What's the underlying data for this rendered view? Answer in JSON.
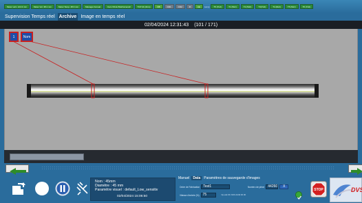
{
  "status_bar": {
    "items": [
      {
        "label": "Meter vel1. 124.3 mm",
        "style": "green"
      },
      {
        "label": "Meter Vel. 38.1 mm",
        "style": "green"
      },
      {
        "label": "Meter Temp. 48.3 mm",
        "style": "green"
      },
      {
        "label": "Manager Annual",
        "style": "green"
      },
      {
        "label": "Cam VKLE Bra/Camera0",
        "style": "green"
      },
      {
        "label": "TCP (0) (0ms)",
        "style": "green"
      },
      {
        "label": "DB",
        "style": "green"
      },
      {
        "label": "CD1",
        "style": "grey"
      },
      {
        "label": "CD2",
        "style": "grey"
      },
      {
        "label": "R",
        "style": "grey"
      },
      {
        "label": "AE",
        "style": "green"
      }
    ],
    "plain": [
      "Lamp",
      "T5 (7Hz)",
      "T1 (5Hz)",
      "T2 (5Hz)",
      "T3(7Hz)",
      "T4 (0Hz)",
      "T5 (5Hz)",
      "T6 (7Hz)"
    ]
  },
  "tabs": [
    {
      "label": "Supervision Temps réel",
      "active": false
    },
    {
      "label": "Archive",
      "active": true
    },
    {
      "label": "Image en temps réel",
      "active": false
    }
  ],
  "header": {
    "timestamp": "02/04/2024 12:31:43",
    "counter": "(101 / 171)"
  },
  "viewer": {
    "markers": [
      {
        "label": "1"
      },
      {
        "label": "Nom"
      }
    ]
  },
  "info": {
    "line1": "Nom : 45mm",
    "line2": "Diamètre : 45 mm",
    "line3": "Paramètre visuel : default_Low_sensitiv",
    "date": "02/04/2024 15:06:50"
  },
  "form": {
    "tabs": [
      {
        "label": "Manuel",
        "active": false
      },
      {
        "label": "Data",
        "active": true
      },
      {
        "label": "Paramètres de sauvegarde d'images",
        "active": false
      }
    ],
    "ordre_label": "Ordre de Fabrication",
    "ordre_value": "Test1",
    "piece_label": "Numéro de pièce",
    "piece_value": "44260",
    "x_button": "X",
    "vitesse_label": "Vitesse d'entrée (%)",
    "vitesse_value": "75",
    "small_note": "Op exist OK / NOK chmW OK OK"
  },
  "stop_button": {
    "label": "STOP"
  },
  "logo": {
    "text": "DVS"
  },
  "colors": {
    "background": "#2a6c9c",
    "viewer_background": "#a8a8a8",
    "marker_border": "#c82020",
    "marker_fill": "#1e4ea8",
    "arrow_green": "#2e8c28",
    "stop_red": "#d42020"
  },
  "icons": [
    "export-icon",
    "record-icon",
    "pause-icon",
    "satellite-icon",
    "next-arrow-icon",
    "prev-arrow-icon",
    "stop-icon",
    "check-icon",
    "logo-icon"
  ]
}
